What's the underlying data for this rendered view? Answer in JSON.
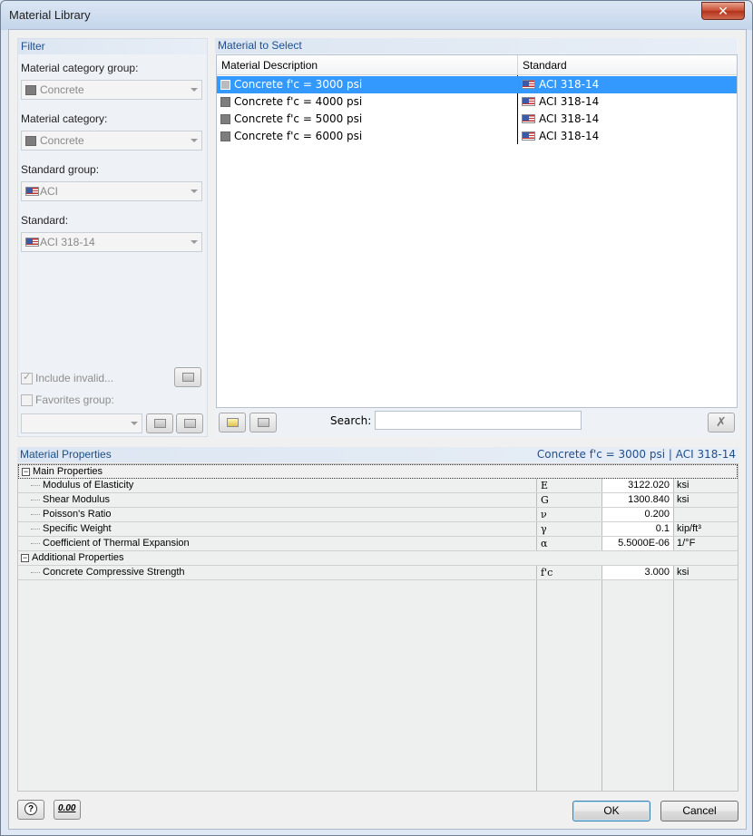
{
  "window": {
    "title": "Material Library",
    "close_glyph": "✕"
  },
  "filter": {
    "header": "Filter",
    "category_group_label": "Material category group:",
    "category_group_value": "Concrete",
    "category_label": "Material category:",
    "category_value": "Concrete",
    "standard_group_label": "Standard group:",
    "standard_group_value": "ACI",
    "standard_label": "Standard:",
    "standard_value": "ACI 318-14",
    "include_invalid_label": "Include invalid...",
    "favorites_group_label": "Favorites group:"
  },
  "material_select": {
    "header": "Material to Select",
    "col_description": "Material Description",
    "col_standard": "Standard",
    "rows": [
      {
        "description": "Concrete f'c = 3000 psi",
        "standard": "ACI 318-14"
      },
      {
        "description": "Concrete f'c = 4000 psi",
        "standard": "ACI 318-14"
      },
      {
        "description": "Concrete f'c = 5000 psi",
        "standard": "ACI 318-14"
      },
      {
        "description": "Concrete f'c = 6000 psi",
        "standard": "ACI 318-14"
      }
    ],
    "search_label": "Search:",
    "search_value": ""
  },
  "properties": {
    "header": "Material Properties",
    "selection_info": "Concrete f'c = 3000 psi  |  ACI 318-14",
    "main_group": "Main Properties",
    "additional_group": "Additional Properties",
    "main": [
      {
        "name": "Modulus of Elasticity",
        "symbol": "E",
        "value": "3122.020",
        "unit": "ksi"
      },
      {
        "name": "Shear Modulus",
        "symbol": "G",
        "value": "1300.840",
        "unit": "ksi"
      },
      {
        "name": "Poisson's Ratio",
        "symbol": "ν",
        "value": "0.200",
        "unit": ""
      },
      {
        "name": "Specific Weight",
        "symbol": "γ",
        "value": "0.1",
        "unit": "kip/ft³"
      },
      {
        "name": "Coefficient of Thermal Expansion",
        "symbol": "α",
        "value": "5.5000E-06",
        "unit": "1/°F"
      }
    ],
    "additional": [
      {
        "name": "Concrete Compressive Strength",
        "symbol": "f'c",
        "value": "3.000",
        "unit": "ksi"
      }
    ]
  },
  "footer": {
    "ok_label": "OK",
    "cancel_label": "Cancel",
    "help_glyph": "?",
    "units_glyph": "0.00"
  }
}
